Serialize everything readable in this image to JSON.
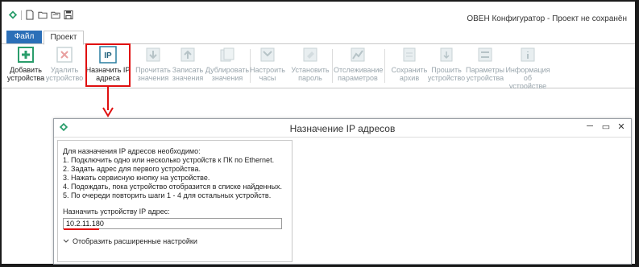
{
  "app": {
    "title": "ОВЕН Конфигуратор - Проект не сохранён"
  },
  "tabs": [
    {
      "label": "Файл"
    },
    {
      "label": "Проект"
    }
  ],
  "ribbon": {
    "buttons": [
      {
        "label": "Добавить\nустройства",
        "icon": "add-icon",
        "enabled": true
      },
      {
        "label": "Удалить\nустройство",
        "icon": "delete-icon",
        "enabled": false
      },
      {
        "label": "Назначить IP\nадреса",
        "icon": "ip-icon",
        "enabled": true
      },
      {
        "label": "Прочитать\nзначения",
        "icon": "read-icon",
        "enabled": false
      },
      {
        "label": "Записать\nзначения",
        "icon": "write-icon",
        "enabled": false
      },
      {
        "label": "Дублировать\nзначения",
        "icon": "duplicate-icon",
        "enabled": false
      },
      {
        "label": "Настроить\nчасы",
        "icon": "clock-icon",
        "enabled": false
      },
      {
        "label": "Установить\nпароль",
        "icon": "password-icon",
        "enabled": false
      },
      {
        "label": "Отслеживание\nпараметров",
        "icon": "chart-icon",
        "enabled": false
      },
      {
        "label": "Сохранить\nархив",
        "icon": "archive-icon",
        "enabled": false
      },
      {
        "label": "Прошить\nустройство",
        "icon": "firmware-icon",
        "enabled": false
      },
      {
        "label": "Параметры\nустройства",
        "icon": "params-icon",
        "enabled": false
      },
      {
        "label": "Информация об\nустройстве",
        "icon": "info-icon",
        "enabled": false
      }
    ]
  },
  "dialog": {
    "title": "Назначение IP адресов",
    "instructions": [
      "Для назначения IP адресов необходимо:",
      "1. Подключить одно или несколько устройств к ПК по Ethernet.",
      "2. Задать адрес для первого устройства.",
      "3. Нажать сервисную кнопку на устройстве.",
      "4. Подождать, пока устройство отобразится в списке найденных.",
      "5. По очереди повторить шаги 1 - 4 для остальных устройств."
    ],
    "ip_label": "Назначить устройству IP адрес:",
    "ip_value": "10.2.11.180",
    "advanced_label": "Отобразить расширенные настройки"
  },
  "colors": {
    "accent": "#2b6fb8",
    "highlight": "#e01010",
    "brand_green": "#2a9d6b"
  }
}
